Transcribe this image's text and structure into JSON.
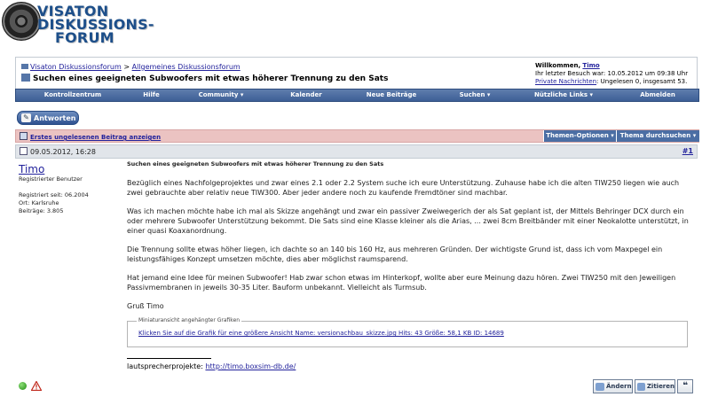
{
  "logo": {
    "line1": "VISATON",
    "line2": "DISKUSSIONS-",
    "line3": "FORUM"
  },
  "breadcrumb": {
    "root": "Visaton Diskussionsforum",
    "sep": ">",
    "section": "Allgemeines Diskussionsforum"
  },
  "thread_title": "Suchen eines geeigneten Subwoofers mit etwas höherer Trennung zu den Sats",
  "welcome": {
    "greeting": "Willkommen,",
    "user": "Timo",
    "last_visit": "Ihr letzter Besuch war: 10.05.2012 um 09:38 Uhr",
    "pm_label": "Private Nachrichten",
    "pm_status": ": Ungelesen 0, insgesamt 53."
  },
  "menu": [
    "Kontrollzentrum",
    "Hilfe",
    "Community ▾",
    "Kalender",
    "Neue Beiträge",
    "Suchen ▾",
    "Nützliche Links ▾",
    "Abmelden"
  ],
  "reply_button": "Antworten",
  "first_unread": "Erstes ungelesenen Beitrag anzeigen",
  "thread_options": "Themen-Optionen ▾",
  "thread_search": "Thema durchsuchen ▾",
  "post": {
    "date": "09.05.2012, 16:28",
    "number": "#1",
    "title": "Suchen eines geeigneten Subwoofers mit etwas höherer Trennung zu den Sats",
    "paragraphs": [
      "Bezüglich eines Nachfolgeprojektes und zwar eines 2.1 oder 2.2 System suche ich eure Unterstützung. Zuhause habe ich die alten TIW250 liegen wie auch zwei gebrauchte aber relativ neue TIW300. Aber jeder andere noch zu kaufende Fremdtöner sind machbar.",
      "Was ich machen möchte habe ich mal als Skizze angehängt und zwar ein passiver Zweiwegerich der als Sat geplant ist, der Mittels Behringer DCX durch ein oder mehrere Subwoofer Unterstützung bekommt. Die Sats sind eine Klasse kleiner als die Arias, ... zwei 8cm Breitbänder mit einer Neokalotte unterstützt, in einer quasi Koaxanordnung.",
      "Die Trennung sollte etwas höher liegen, ich dachte so an 140 bis 160 Hz, aus mehreren Gründen. Der wichtigste Grund ist, dass ich vom Maxpegel ein leistungsfähiges Konzept umsetzen möchte, dies aber möglichst raumsparend.",
      "Hat jemand eine Idee für meinen Subwoofer! Hab zwar schon etwas im Hinterkopf, wollte aber eure Meinung dazu hören. Zwei TIW250 mit den Jeweiligen Passivmembranen in jeweils 30-35 Liter. Bauform unbekannt. Vielleicht als Turmsub.",
      "Gruß Timo"
    ],
    "attachments_legend": "Miniaturansicht angehängter Grafiken",
    "attachment_link": "Klicken Sie auf die Grafik für eine größere Ansicht Name: versionachbau_skizze.jpg Hits: 43 Größe: 58,1 KB ID: 14689",
    "signature_prefix": "lautsprecherprojekte:",
    "signature_link": "http://timo.boxsim-db.de/"
  },
  "author": {
    "name": "Timo",
    "rank": "Registrierter Benutzer",
    "joined": "Registriert seit: 06.2004",
    "location": "Ort: Karlsruhe",
    "posts": "Beiträge: 3.805"
  },
  "actions": {
    "edit": "Ändern",
    "quote": "Zitieren"
  },
  "colors": {
    "menu": "#3d5f96",
    "unread_bar": "#ebc3c2",
    "link": "#22229c"
  }
}
